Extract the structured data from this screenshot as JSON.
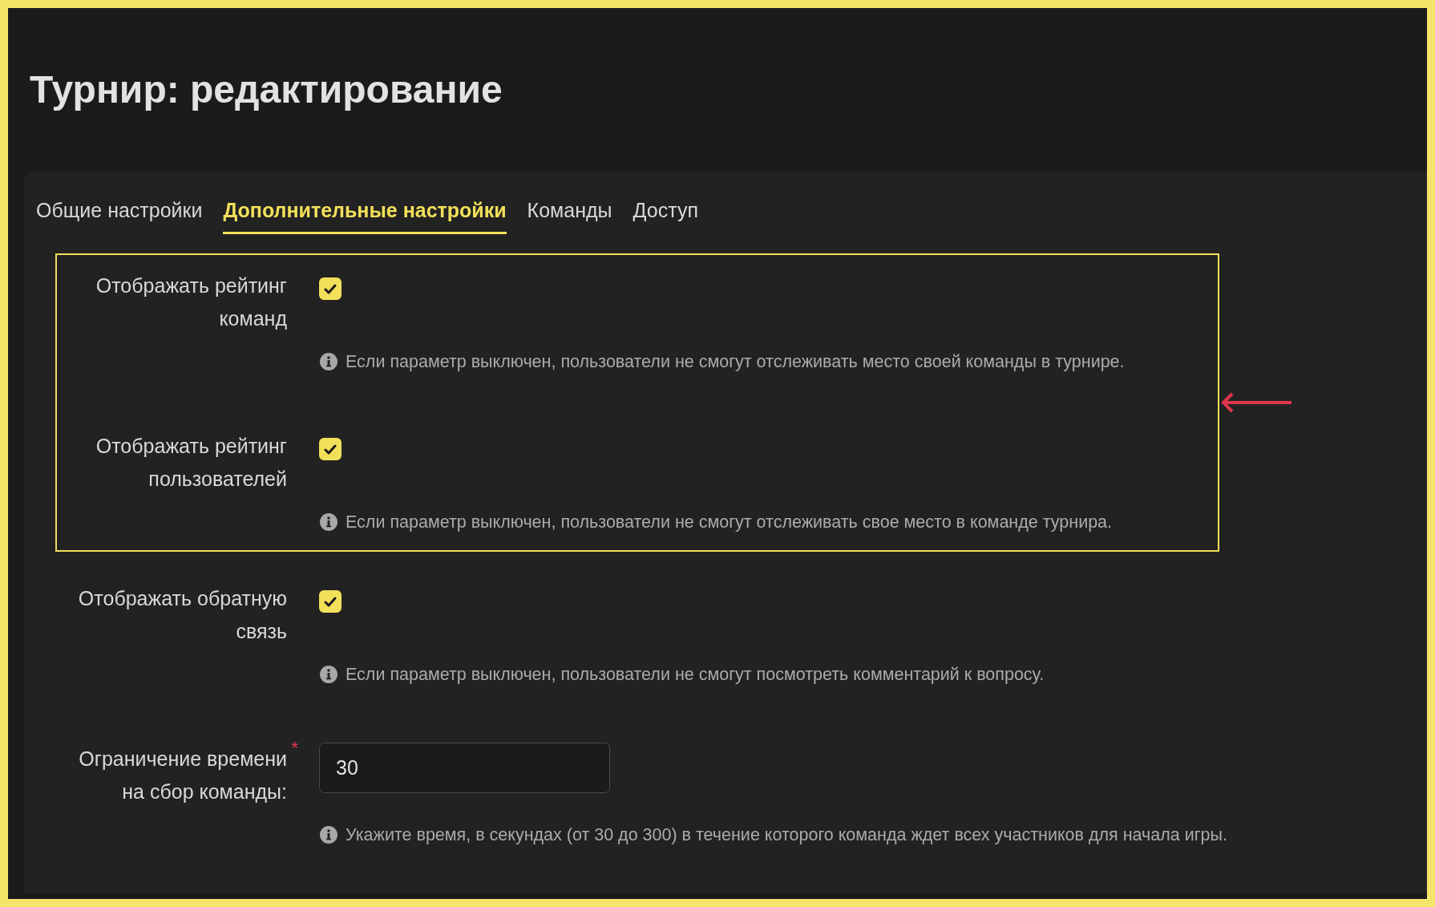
{
  "title": "Турнир: редактирование",
  "tabs": [
    {
      "label": "Общие настройки",
      "selected": false
    },
    {
      "label": "Дополнительные настройки",
      "selected": true
    },
    {
      "label": "Команды",
      "selected": false
    },
    {
      "label": "Доступ",
      "selected": false
    }
  ],
  "highlighted_settings": [
    {
      "kind": "checkbox",
      "label": "Отображать рейтинг команд",
      "checked": true,
      "help": "Если параметр выключен, пользователи не смогут отслеживать место своей команды в турнире."
    },
    {
      "kind": "checkbox",
      "label": "Отображать рейтинг пользователей",
      "checked": true,
      "help": "Если параметр выключен, пользователи не смогут отслеживать свое место в команде турнира."
    }
  ],
  "settings": [
    {
      "kind": "checkbox",
      "label": "Отображать обратную связь",
      "checked": true,
      "help": "Если параметр выключен, пользователи не смогут посмотреть комментарий к вопросу."
    },
    {
      "kind": "number",
      "label": "Ограничение времени на сбор команды:",
      "required_mark": "*",
      "value": "30",
      "help": "Укажите время, в секундах (от 30 до 300) в течение которого команда ждет всех участников для начала игры."
    }
  ]
}
